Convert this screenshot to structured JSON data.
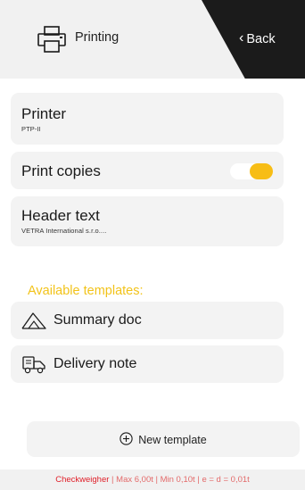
{
  "header": {
    "title": "Printing",
    "back_label": "Back",
    "icon": "printer-icon"
  },
  "settings": {
    "printer": {
      "label": "Printer",
      "value": "PTP-II"
    },
    "print_copies": {
      "label": "Print copies",
      "enabled": true
    },
    "header_text": {
      "label": "Header text",
      "value": "VETRA International s.r.o...."
    }
  },
  "templates": {
    "section_title": "Available templates:",
    "items": [
      {
        "label": "Summary doc",
        "icon": "summary-mountain-icon"
      },
      {
        "label": "Delivery note",
        "icon": "delivery-truck-icon"
      }
    ],
    "new_label": "New template"
  },
  "footer": {
    "brand": "Checkweigher",
    "specs": " | Max 6,00t | Min 0,10t | e = d = 0,01t"
  },
  "colors": {
    "accent": "#f7bd15",
    "section_title": "#f2c31a",
    "brand_red": "#e0202a",
    "header_dark": "#1b1b1b"
  }
}
